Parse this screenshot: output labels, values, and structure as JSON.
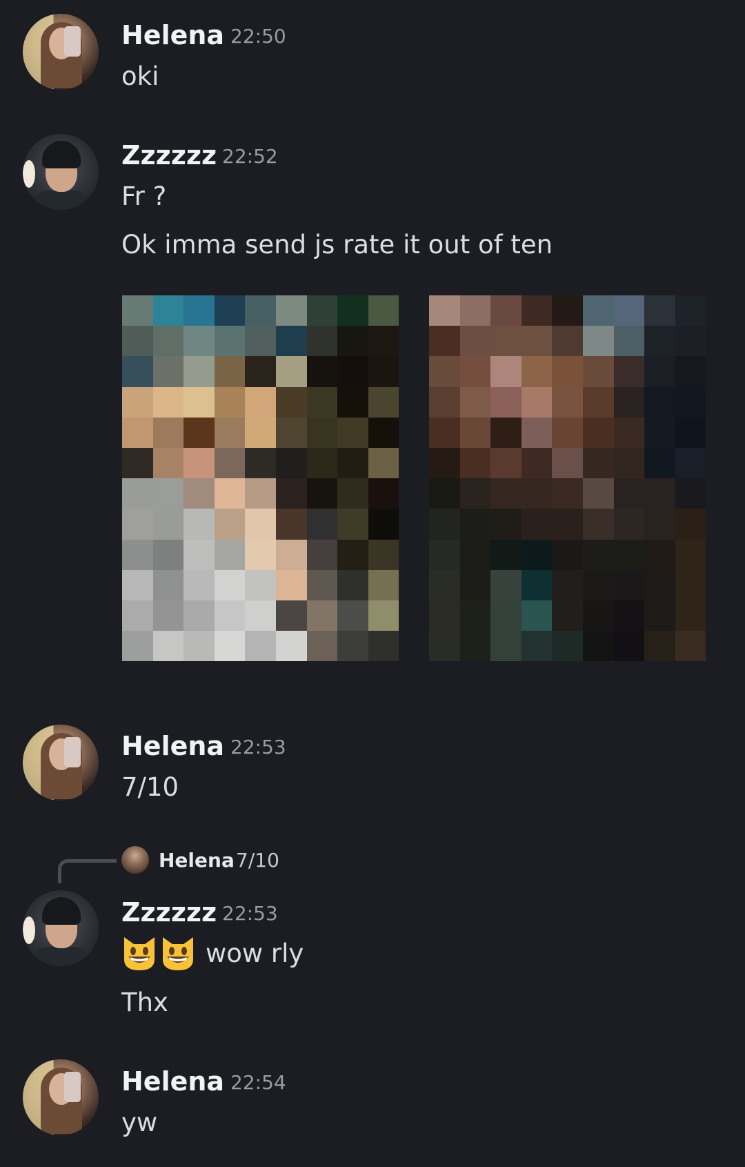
{
  "messages": [
    {
      "author": "Helena",
      "time": "22:50",
      "lines": [
        "oki"
      ]
    },
    {
      "author": "Zzzzzz",
      "time": "22:52",
      "lines": [
        "Fr ?",
        "Ok imma send js rate it out of ten"
      ]
    },
    {
      "author": "Helena",
      "time": "22:53",
      "lines": [
        "7/10"
      ]
    },
    {
      "author": "Zzzzzz",
      "time": "22:53",
      "lines": [
        "wow rly",
        "Thx"
      ],
      "reply": {
        "author": "Helena",
        "text": "7/10"
      },
      "emojis": [
        "smiling-cat-icon",
        "smiling-cat-icon"
      ]
    },
    {
      "author": "Helena",
      "time": "22:54",
      "lines": [
        "yw"
      ]
    }
  ],
  "attachments": [
    {
      "name": "censored-photo-1"
    },
    {
      "name": "censored-photo-2"
    }
  ],
  "colors": {
    "background": "#1c1d22",
    "name": "#f2f3f5",
    "timestamp": "#9a9ca4",
    "text": "#dcdde1"
  }
}
